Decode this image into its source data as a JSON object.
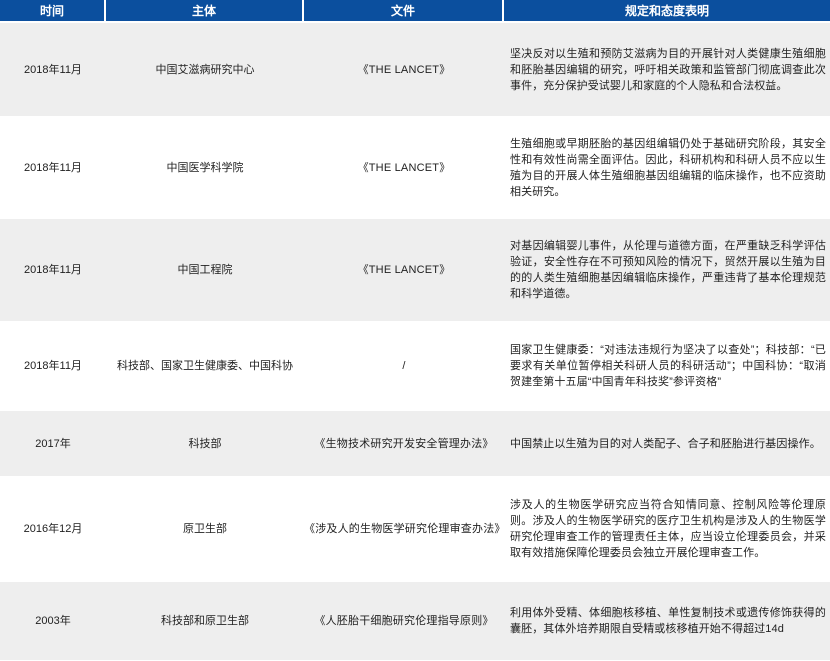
{
  "headers": [
    "时间",
    "主体",
    "文件",
    "规定和态度表明"
  ],
  "rows": [
    {
      "time": "2018年11月",
      "body": "中国艾滋病研究中心",
      "doc": "《THE LANCET》",
      "desc": "坚决反对以生殖和预防艾滋病为目的开展针对人类健康生殖细胞和胚胎基因编辑的研究，呼吁相关政策和监管部门彻底调查此次事件，充分保护受试婴儿和家庭的个人隐私和合法权益。"
    },
    {
      "time": "2018年11月",
      "body": "中国医学科学院",
      "doc": "《THE LANCET》",
      "desc": "生殖细胞或早期胚胎的基因组编辑仍处于基础研究阶段，其安全性和有效性尚需全面评估。因此，科研机构和科研人员不应以生殖为目的开展人体生殖细胞基因组编辑的临床操作，也不应资助相关研究。"
    },
    {
      "time": "2018年11月",
      "body": "中国工程院",
      "doc": "《THE LANCET》",
      "desc": "对基因编辑婴儿事件，从伦理与道德方面，在严重缺乏科学评估验证，安全性存在不可预知风险的情况下，贸然开展以生殖为目的的人类生殖细胞基因编辑临床操作，严重违背了基本伦理规范和科学道德。"
    },
    {
      "time": "2018年11月",
      "body": "科技部、国家卫生健康委、中国科协",
      "doc": "/",
      "desc": "国家卫生健康委：“对违法违规行为坚决了以查处”；科技部：“已要求有关单位暂停相关科研人员的科研活动”；中国科协：“取消贺建奎第十五届“中国青年科技奖”参评资格”"
    },
    {
      "time": "2017年",
      "body": "科技部",
      "doc": "《生物技术研究开发安全管理办法》",
      "desc": "中国禁止以生殖为目的对人类配子、合子和胚胎进行基因操作。"
    },
    {
      "time": "2016年12月",
      "body": "原卫生部",
      "doc": "《涉及人的生物医学研究伦理审查办法》",
      "desc": "涉及人的生物医学研究应当符合知情同意、控制风险等伦理原则。涉及人的生物医学研究的医疗卫生机构是涉及人的生物医学研究伦理审查工作的管理责任主体，应当设立伦理委员会，并采取有效措施保障伦理委员会独立开展伦理审查工作。"
    },
    {
      "time": "2003年",
      "body": "科技部和原卫生部",
      "doc": "《人胚胎干细胞研究伦理指导原则》",
      "desc": "利用体外受精、体细胞核移植、单性复制技术或遗传修饰获得的囊胚，其体外培养期限自受精或核移植开始不得超过14d"
    }
  ]
}
